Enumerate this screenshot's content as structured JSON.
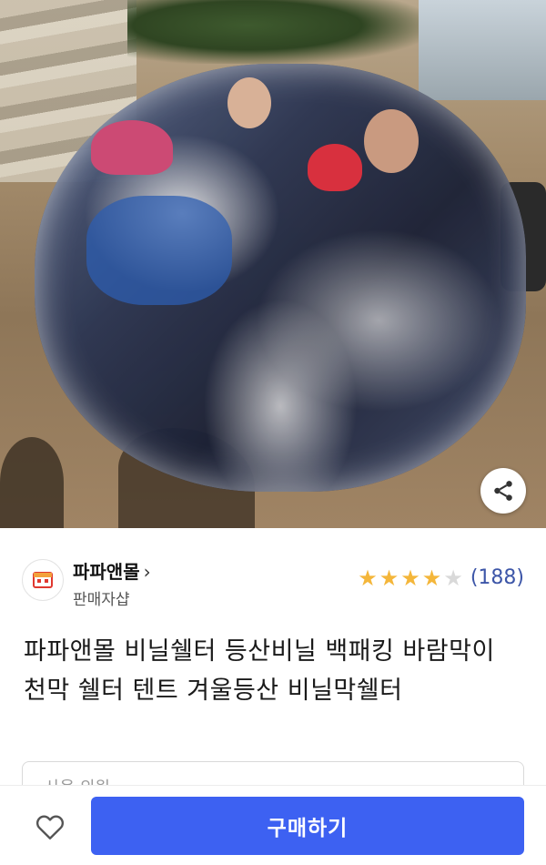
{
  "photo": {
    "alt_icon": "product-photo",
    "share_icon": "share-icon"
  },
  "seller": {
    "name": "파파앤몰",
    "chevron": "›",
    "subtitle": "판매자샵",
    "logo_icon": "store-logo-icon"
  },
  "rating": {
    "stars_filled": 4,
    "stars_total": 5,
    "count": "(188)",
    "star_color": "#f4b63a"
  },
  "product": {
    "title": "파파앤몰 비닐쉘터 등산비닐 백패킹 바람막이 천막 쉘터 텐트 겨울등산 비닐막쉘터"
  },
  "option": {
    "placeholder": "사용 의원"
  },
  "bottom": {
    "wish_icon": "heart-icon",
    "buy_label": "구매하기",
    "buy_color": "#3d61f2"
  }
}
